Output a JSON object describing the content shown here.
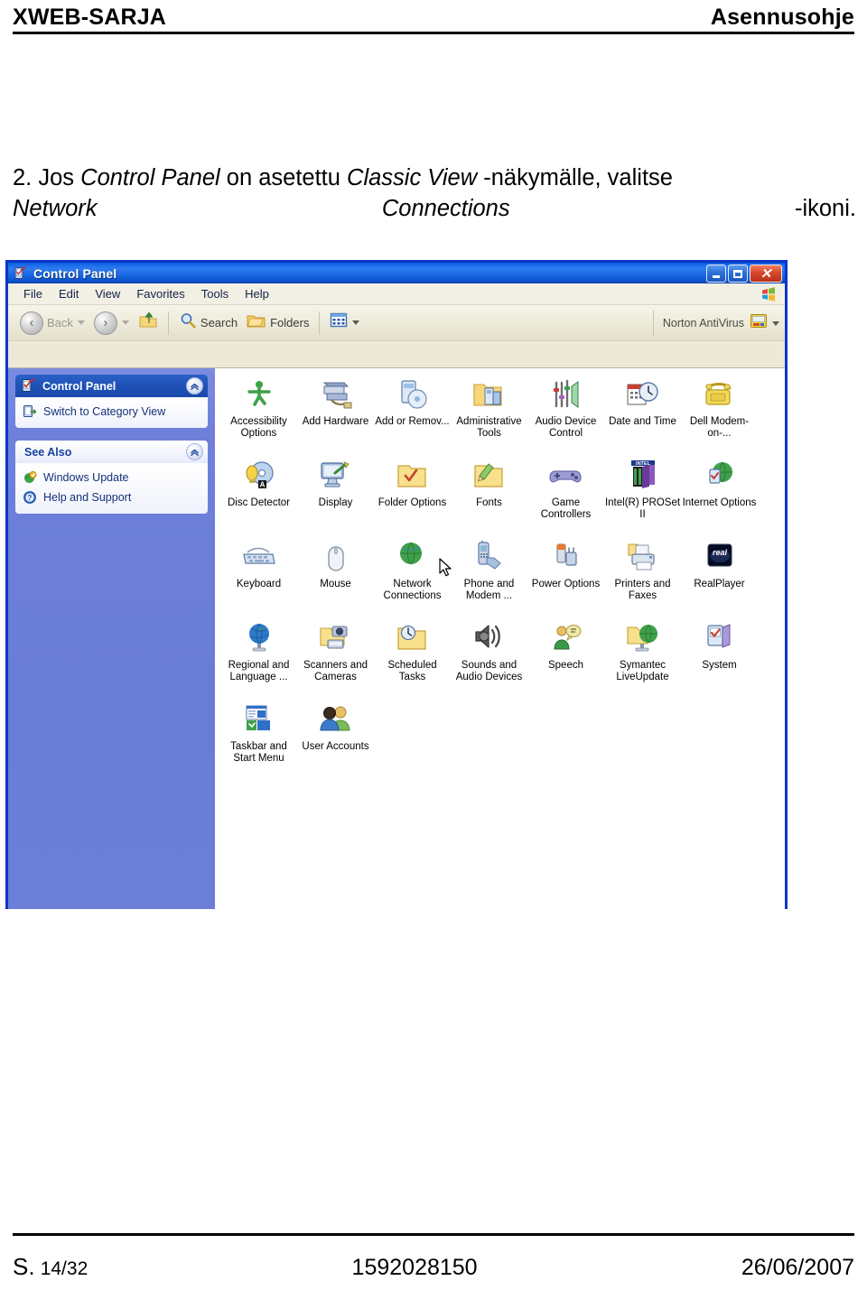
{
  "header": {
    "left": "XWEB-SARJA",
    "right": "Asennusohje"
  },
  "body": {
    "line1_num": "2.",
    "line1_a": "Jos",
    "line1_b": "Control Panel",
    "line1_c": "on asetettu",
    "line1_d": "Classic View",
    "line1_e": "-näkymälle, valitse",
    "line2_a": "Network",
    "line2_b": "Connections",
    "line2_c": "-ikoni."
  },
  "window": {
    "title": "Control Panel",
    "title_icon": "control-panel-icon",
    "buttons": {
      "minimize": "Minimize",
      "maximize": "Maximize",
      "close": "Close"
    },
    "menu": [
      "File",
      "Edit",
      "View",
      "Favorites",
      "Tools",
      "Help"
    ],
    "toolbar": {
      "back": "Back",
      "forward": "",
      "up": "",
      "search": "Search",
      "folders": "Folders",
      "views": "",
      "norton": "Norton AntiVirus"
    },
    "sidebar": {
      "panel1": {
        "title": "Control Panel",
        "icon": "control-panel-icon",
        "collapse": "chevron-up-icon",
        "links": [
          {
            "label": "Switch to Category View",
            "icon": "category-view-icon"
          }
        ]
      },
      "panel2": {
        "title": "See Also",
        "collapse": "chevron-up-icon",
        "links": [
          {
            "label": "Windows Update",
            "icon": "windows-update-icon"
          },
          {
            "label": "Help and Support",
            "icon": "help-support-icon"
          }
        ]
      }
    },
    "icons": [
      [
        {
          "label": "Accessibility Options",
          "icon": "accessibility-icon"
        },
        {
          "label": "Add Hardware",
          "icon": "add-hardware-icon"
        },
        {
          "label": "Add or Remov...",
          "icon": "add-remove-programs-icon"
        },
        {
          "label": "Administrative Tools",
          "icon": "administrative-tools-icon"
        },
        {
          "label": "Audio Device Control",
          "icon": "audio-device-icon"
        },
        {
          "label": "Date and Time",
          "icon": "date-time-icon"
        },
        {
          "label": "Dell Modem-on-...",
          "icon": "dell-modem-icon"
        }
      ],
      [
        {
          "label": "Disc Detector",
          "icon": "disc-detector-icon"
        },
        {
          "label": "Display",
          "icon": "display-icon"
        },
        {
          "label": "Folder Options",
          "icon": "folder-options-icon"
        },
        {
          "label": "Fonts",
          "icon": "fonts-icon"
        },
        {
          "label": "Game Controllers",
          "icon": "game-controllers-icon"
        },
        {
          "label": "Intel(R) PROSet II",
          "icon": "intel-proset-icon"
        },
        {
          "label": "Internet Options",
          "icon": "internet-options-icon"
        }
      ],
      [
        {
          "label": "Keyboard",
          "icon": "keyboard-icon"
        },
        {
          "label": "Mouse",
          "icon": "mouse-icon"
        },
        {
          "label": "Network Connections",
          "icon": "network-connections-icon"
        },
        {
          "label": "Phone and Modem ...",
          "icon": "phone-modem-icon"
        },
        {
          "label": "Power Options",
          "icon": "power-options-icon"
        },
        {
          "label": "Printers and Faxes",
          "icon": "printers-faxes-icon"
        },
        {
          "label": "RealPlayer",
          "icon": "realplayer-icon"
        }
      ],
      [
        {
          "label": "Regional and Language ...",
          "icon": "regional-language-icon"
        },
        {
          "label": "Scanners and Cameras",
          "icon": "scanners-cameras-icon"
        },
        {
          "label": "Scheduled Tasks",
          "icon": "scheduled-tasks-icon"
        },
        {
          "label": "Sounds and Audio Devices",
          "icon": "sounds-audio-icon"
        },
        {
          "label": "Speech",
          "icon": "speech-icon"
        },
        {
          "label": "Symantec LiveUpdate",
          "icon": "symantec-liveupdate-icon"
        },
        {
          "label": "System",
          "icon": "system-icon"
        }
      ],
      [
        {
          "label": "Taskbar and Start Menu",
          "icon": "taskbar-start-menu-icon"
        },
        {
          "label": "User Accounts",
          "icon": "user-accounts-icon"
        }
      ]
    ]
  },
  "footer": {
    "page_prefix": "S.",
    "page_value": "14/32",
    "doc_number": "1592028150",
    "date": "26/06/2007"
  },
  "colors": {
    "title_blue": "#1766E2",
    "window_border": "#0A36C8",
    "sidebar_blue": "#6E80DA",
    "panel_header_blue": "#1F51B6",
    "chrome_beige": "#ECE9D8",
    "close_red": "#D8472A"
  }
}
